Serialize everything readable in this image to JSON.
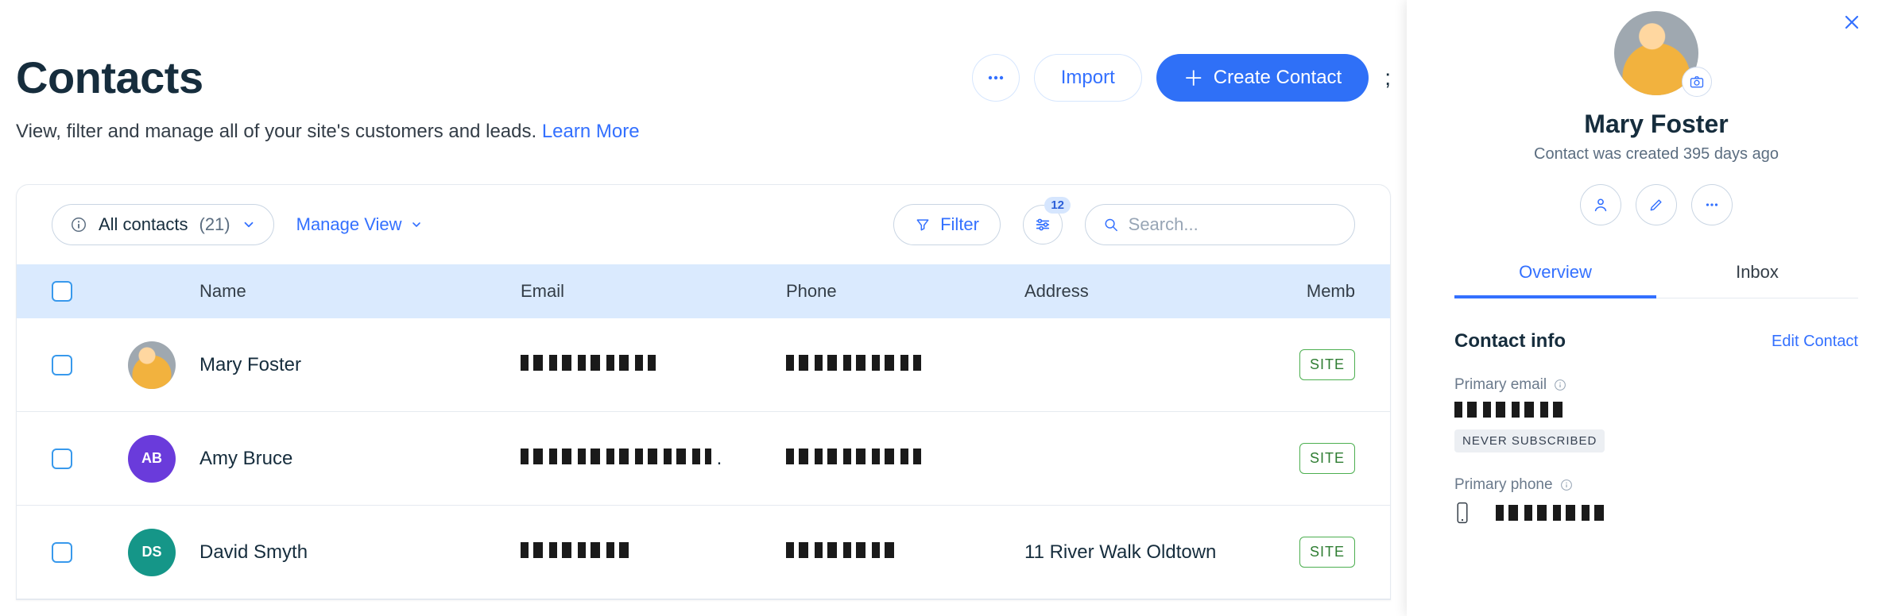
{
  "header": {
    "title": "Contacts",
    "subtitle_prefix": "View, filter and manage all of your site's customers and leads. ",
    "learn_more": "Learn More",
    "import_label": "Import",
    "create_label": "Create Contact"
  },
  "toolbar": {
    "selector_label": "All contacts",
    "selector_count": "(21)",
    "manage_view": "Manage View",
    "filter_label": "Filter",
    "adjust_badge": "12",
    "search_placeholder": "Search..."
  },
  "table": {
    "columns": {
      "name": "Name",
      "email": "Email",
      "phone": "Phone",
      "address": "Address",
      "member": "Memb"
    },
    "rows": [
      {
        "name": "Mary Foster",
        "address": "",
        "avatar": "img",
        "initials": "",
        "badge": "SITE"
      },
      {
        "name": "Amy Bruce",
        "address": "",
        "avatar": "purple",
        "initials": "AB",
        "badge": "SITE"
      },
      {
        "name": "David Smyth",
        "address": "11 River Walk Oldtown",
        "avatar": "teal",
        "initials": "DS",
        "badge": "SITE"
      }
    ]
  },
  "panel": {
    "name": "Mary Foster",
    "created_text": "Contact was created 395 days ago",
    "tabs": {
      "overview": "Overview",
      "inbox": "Inbox"
    },
    "section_title": "Contact info",
    "edit_label": "Edit Contact",
    "primary_email_label": "Primary email",
    "never_subscribed": "NEVER SUBSCRIBED",
    "primary_phone_label": "Primary phone"
  }
}
